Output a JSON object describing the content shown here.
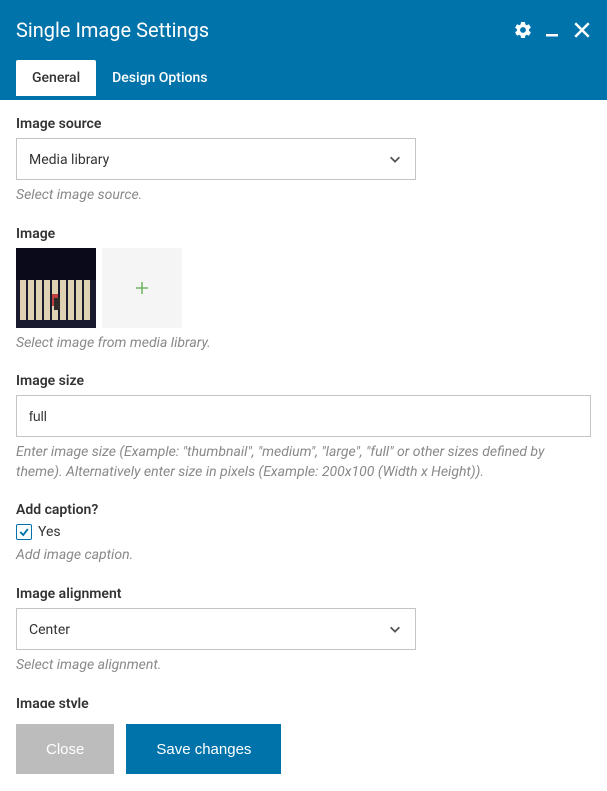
{
  "header": {
    "title": "Single Image Settings"
  },
  "tabs": {
    "general": "General",
    "design": "Design Options"
  },
  "source": {
    "label": "Image source",
    "value": "Media library",
    "hint": "Select image source."
  },
  "image": {
    "label": "Image",
    "hint": "Select image from media library."
  },
  "size": {
    "label": "Image size",
    "value": "full",
    "hint": "Enter image size (Example: \"thumbnail\", \"medium\", \"large\", \"full\" or other sizes defined by theme). Alternatively enter size in pixels (Example: 200x100 (Width x Height))."
  },
  "caption": {
    "label": "Add caption?",
    "checkbox_label": "Yes",
    "hint": "Add image caption."
  },
  "alignment": {
    "label": "Image alignment",
    "value": "Center",
    "hint": "Select image alignment."
  },
  "style": {
    "label": "Image style"
  },
  "footer": {
    "close": "Close",
    "save": "Save changes"
  }
}
